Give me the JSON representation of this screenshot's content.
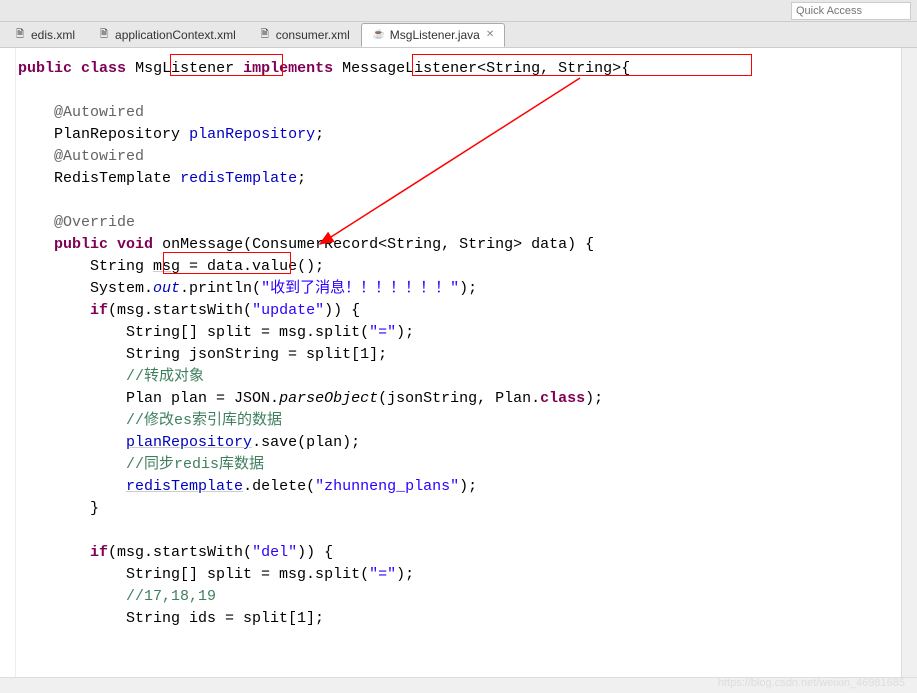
{
  "topbar": {
    "quick_access_placeholder": "Quick Access"
  },
  "tabs": [
    {
      "label": "edis.xml",
      "icon": "🗎",
      "active": false
    },
    {
      "label": "applicationContext.xml",
      "icon": "🗎",
      "active": false
    },
    {
      "label": "consumer.xml",
      "icon": "🗎",
      "active": false
    },
    {
      "label": "MsgListener.java",
      "icon": "☕",
      "active": true
    }
  ],
  "code": {
    "line1_kw1": "public",
    "line1_kw2": "class",
    "line1_class": "MsgListener",
    "line1_kw3": "implements",
    "line1_iface": "MessageListener<String, String>",
    "line1_brace": "{",
    "ann_autowired": "@Autowired",
    "field1_type": "PlanRepository",
    "field1_name": "planRepository",
    "field2_type": "RedisTemplate",
    "field2_name": "redisTemplate",
    "ann_override": "@Override",
    "method_kw1": "public",
    "method_kw2": "void",
    "method_name": "onMessage",
    "method_params": "(ConsumerRecord<String, String> data) {",
    "body_l1_a": "String ",
    "body_l1_b": "msg",
    "body_l1_c": " = data.value();",
    "body_l2_a": "System.",
    "body_l2_out": "out",
    "body_l2_b": ".println(",
    "body_l2_str": "\"收到了消息！！！！！！！\"",
    "body_l2_c": ");",
    "body_l3_a": "if",
    "body_l3_b": "(msg.startsWith(",
    "body_l3_str": "\"update\"",
    "body_l3_c": ")) {",
    "body_l4_a": "String[] split = msg.split(",
    "body_l4_str": "\"=\"",
    "body_l4_b": ");",
    "body_l5": "String jsonString = split[1];",
    "body_l6_cmt": "//转成对象",
    "body_l7_a": "Plan plan = JSON.",
    "body_l7_m": "parseObject",
    "body_l7_b": "(jsonString, Plan.",
    "body_l7_kw": "class",
    "body_l7_c": ");",
    "body_l8_cmt": "//修改es索引库的数据",
    "body_l9_a": "planRepository",
    "body_l9_b": ".save(plan);",
    "body_l10_cmt": "//同步redis库数据",
    "body_l11_a": "redisTemplate",
    "body_l11_b": ".delete(",
    "body_l11_str": "\"zhunneng_plans\"",
    "body_l11_c": ");",
    "body_l12": "}",
    "body_l14_a": "if",
    "body_l14_b": "(msg.startsWith(",
    "body_l14_str": "\"del\"",
    "body_l14_c": ")) {",
    "body_l15_a": "String[] split = msg.split(",
    "body_l15_str": "\"=\"",
    "body_l15_b": ");",
    "body_l16_cmt": "//17,18,19",
    "body_l17": "String ids = split[1];"
  },
  "watermark": "https://blog.csdn.net/weixin_46981685"
}
